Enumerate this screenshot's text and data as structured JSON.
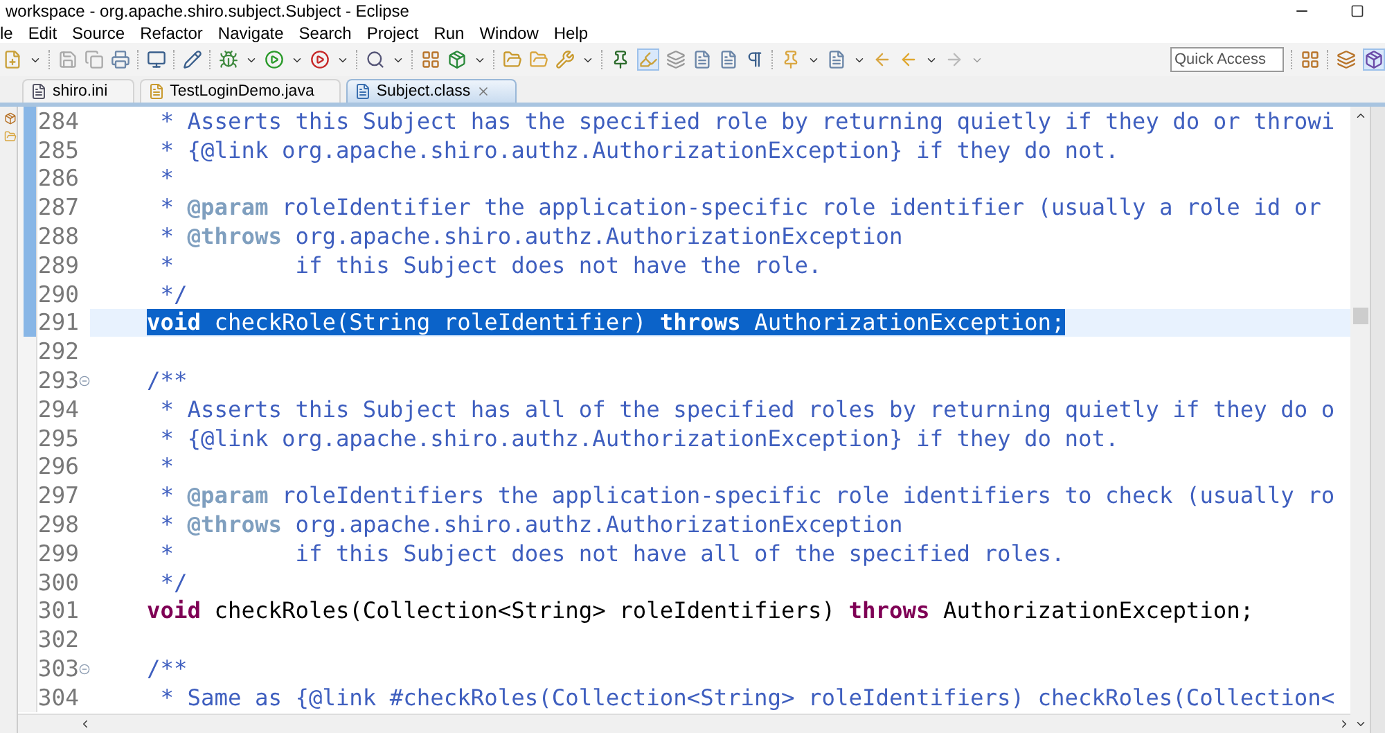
{
  "window": {
    "title": "workspace - org.apache.shiro.subject.Subject - Eclipse"
  },
  "menu": [
    "le",
    "Edit",
    "Source",
    "Refactor",
    "Navigate",
    "Search",
    "Project",
    "Run",
    "Window",
    "Help"
  ],
  "toolbar": {
    "quick_access": {
      "placeholder": "Quick Access"
    }
  },
  "tabs": [
    {
      "label": "shiro.ini",
      "selected": false,
      "kind": "text"
    },
    {
      "label": "TestLoginDemo.java",
      "selected": false,
      "kind": "java"
    },
    {
      "label": "Subject.class",
      "selected": true,
      "kind": "class"
    }
  ],
  "editor": {
    "lines": [
      {
        "number": "284",
        "fold": false,
        "in_range": true,
        "selected": false,
        "segments": [
          {
            "kind": "comment",
            "text": " * Asserts this Subject has the specified role by returning quietly if they do or throwi"
          }
        ]
      },
      {
        "number": "285",
        "fold": false,
        "in_range": true,
        "selected": false,
        "segments": [
          {
            "kind": "comment",
            "text": " * {@link org.apache.shiro.authz.AuthorizationException} if they do not."
          }
        ]
      },
      {
        "number": "286",
        "fold": false,
        "in_range": true,
        "selected": false,
        "segments": [
          {
            "kind": "comment",
            "text": " *"
          }
        ]
      },
      {
        "number": "287",
        "fold": false,
        "in_range": true,
        "selected": false,
        "segments": [
          {
            "kind": "comment",
            "text": " * "
          },
          {
            "kind": "tag",
            "text": "@param"
          },
          {
            "kind": "comment",
            "text": " roleIdentifier the application-specific role identifier (usually a role id or"
          }
        ]
      },
      {
        "number": "288",
        "fold": false,
        "in_range": true,
        "selected": false,
        "segments": [
          {
            "kind": "comment",
            "text": " * "
          },
          {
            "kind": "tag",
            "text": "@throws"
          },
          {
            "kind": "comment",
            "text": " org.apache.shiro.authz.AuthorizationException"
          }
        ]
      },
      {
        "number": "289",
        "fold": false,
        "in_range": true,
        "selected": false,
        "segments": [
          {
            "kind": "comment",
            "text": " *         if this Subject does not have the role."
          }
        ]
      },
      {
        "number": "290",
        "fold": false,
        "in_range": true,
        "selected": false,
        "segments": [
          {
            "kind": "comment",
            "text": " */"
          }
        ]
      },
      {
        "number": "291",
        "fold": false,
        "in_range": true,
        "selected": true,
        "segments": [
          {
            "kind": "keyword",
            "text": "void"
          },
          {
            "kind": "plain",
            "text": " checkRole(String roleIdentifier) "
          },
          {
            "kind": "keyword",
            "text": "throws"
          },
          {
            "kind": "plain",
            "text": " AuthorizationException;"
          }
        ]
      },
      {
        "number": "292",
        "fold": false,
        "in_range": false,
        "selected": false
      },
      {
        "number": "293",
        "fold": true,
        "in_range": false,
        "selected": false,
        "segments": [
          {
            "kind": "comment",
            "text": "/**"
          }
        ]
      },
      {
        "number": "294",
        "fold": false,
        "in_range": false,
        "selected": false,
        "segments": [
          {
            "kind": "comment",
            "text": " * Asserts this Subject has all of the specified roles by returning quietly if they do o"
          }
        ]
      },
      {
        "number": "295",
        "fold": false,
        "in_range": false,
        "selected": false,
        "segments": [
          {
            "kind": "comment",
            "text": " * {@link org.apache.shiro.authz.AuthorizationException} if they do not."
          }
        ]
      },
      {
        "number": "296",
        "fold": false,
        "in_range": false,
        "selected": false,
        "segments": [
          {
            "kind": "comment",
            "text": " *"
          }
        ]
      },
      {
        "number": "297",
        "fold": false,
        "in_range": false,
        "selected": false,
        "segments": [
          {
            "kind": "comment",
            "text": " * "
          },
          {
            "kind": "tag",
            "text": "@param"
          },
          {
            "kind": "comment",
            "text": " roleIdentifiers the application-specific role identifiers to check (usually ro"
          }
        ]
      },
      {
        "number": "298",
        "fold": false,
        "in_range": false,
        "selected": false,
        "segments": [
          {
            "kind": "comment",
            "text": " * "
          },
          {
            "kind": "tag",
            "text": "@throws"
          },
          {
            "kind": "comment",
            "text": " org.apache.shiro.authz.AuthorizationException"
          }
        ]
      },
      {
        "number": "299",
        "fold": false,
        "in_range": false,
        "selected": false,
        "segments": [
          {
            "kind": "comment",
            "text": " *         if this Subject does not have all of the specified roles."
          }
        ]
      },
      {
        "number": "300",
        "fold": false,
        "in_range": false,
        "selected": false,
        "segments": [
          {
            "kind": "comment",
            "text": " */"
          }
        ]
      },
      {
        "number": "301",
        "fold": false,
        "in_range": false,
        "selected": false,
        "segments": [
          {
            "kind": "keyword",
            "text": "void"
          },
          {
            "kind": "plain",
            "text": " checkRoles(Collection<String> roleIdentifiers) "
          },
          {
            "kind": "keyword",
            "text": "throws"
          },
          {
            "kind": "plain",
            "text": " AuthorizationException;"
          }
        ]
      },
      {
        "number": "302",
        "fold": false,
        "in_range": false,
        "selected": false
      },
      {
        "number": "303",
        "fold": true,
        "in_range": false,
        "selected": false,
        "segments": [
          {
            "kind": "comment",
            "text": "/**"
          }
        ]
      },
      {
        "number": "304",
        "fold": false,
        "in_range": false,
        "selected": false,
        "segments": [
          {
            "kind": "comment",
            "text": " * Same as {@link #checkRoles(Collection<String> roleIdentifiers) checkRoles(Collection<"
          }
        ]
      }
    ]
  }
}
